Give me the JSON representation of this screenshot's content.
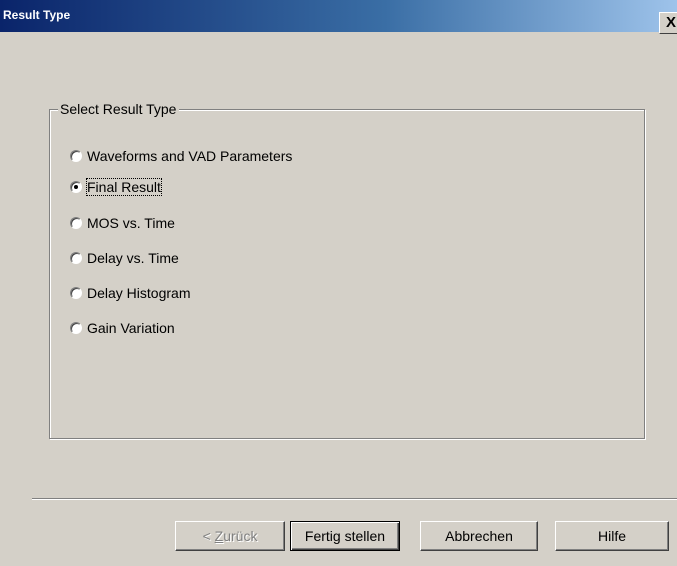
{
  "window": {
    "title": "Result Type",
    "close_glyph": "X"
  },
  "group": {
    "legend": "Select Result Type",
    "options": [
      {
        "label": "Waveforms and VAD Parameters",
        "checked": false
      },
      {
        "label": "Final Result",
        "checked": true
      },
      {
        "label": "MOS vs. Time",
        "checked": false
      },
      {
        "label": "Delay vs. Time",
        "checked": false
      },
      {
        "label": "Delay Histogram",
        "checked": false
      },
      {
        "label": "Gain Variation",
        "checked": false
      }
    ]
  },
  "buttons": {
    "back_prefix": "< ",
    "back_mnemonic": "Z",
    "back_rest": "urück",
    "finish": "Fertig stellen",
    "cancel": "Abbrechen",
    "help": "Hilfe"
  },
  "colors": {
    "titlebar_start": "#0a246a",
    "titlebar_end": "#a6caf0",
    "face": "#d4d0c8"
  }
}
